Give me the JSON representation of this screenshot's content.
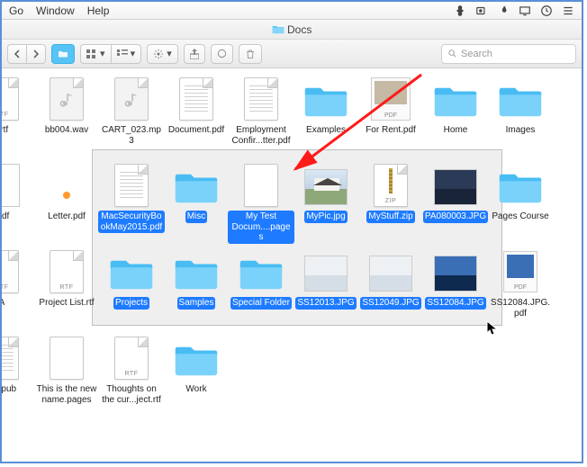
{
  "menubar": {
    "items": [
      "Go",
      "Window",
      "Help"
    ]
  },
  "window": {
    "title": "Docs"
  },
  "toolbar": {
    "search_placeholder": "Search"
  },
  "files": {
    "row1": [
      {
        "name": "r.rtf",
        "type": "rtf"
      },
      {
        "name": "bb004.wav",
        "type": "audio"
      },
      {
        "name": "CART_023.mp3",
        "type": "audio"
      },
      {
        "name": "Document.pdf",
        "type": "doc"
      },
      {
        "name": "Employment Confir...tter.pdf",
        "type": "doc"
      },
      {
        "name": "Examples",
        "type": "folder"
      },
      {
        "name": "For Rent.pdf",
        "type": "pdfimg"
      },
      {
        "name": "Home",
        "type": "folder"
      },
      {
        "name": "Images",
        "type": "folder"
      }
    ],
    "row2": [
      {
        "name": ".pdf",
        "type": "spiral"
      },
      {
        "name": "Letter.pdf",
        "type": "dot"
      },
      {
        "name": "MacSecurityBookMay2015.pdf",
        "type": "doc",
        "selected": true
      },
      {
        "name": "Misc",
        "type": "folder",
        "selected": true
      },
      {
        "name": "My Test Docum....pages",
        "type": "blank",
        "selected": true
      },
      {
        "name": "MyPic.jpg",
        "type": "img-house",
        "selected": true
      },
      {
        "name": "MyStuff.zip",
        "type": "zip",
        "selected": true
      },
      {
        "name": "PA080003.JPG",
        "type": "img-dark",
        "selected": true
      },
      {
        "name": "Pages Course",
        "type": "folder"
      }
    ],
    "row3": [
      {
        "name": "A",
        "type": "rtf"
      },
      {
        "name": "Project List.rtf",
        "type": "rtf"
      },
      {
        "name": "Projects",
        "type": "folder",
        "selected": true
      },
      {
        "name": "Samples",
        "type": "folder",
        "selected": true
      },
      {
        "name": "Special Folder",
        "type": "folder",
        "selected": true
      },
      {
        "name": "SS12013.JPG",
        "type": "img-plain",
        "selected": true
      },
      {
        "name": "SS12049.JPG",
        "type": "img-plain",
        "selected": true
      },
      {
        "name": "SS12084.JPG",
        "type": "img-blue",
        "selected": true
      },
      {
        "name": "SS12084.JPG.pdf",
        "type": "pdfsmall"
      }
    ],
    "row4": [
      {
        "name": "cal pub",
        "type": "doc"
      },
      {
        "name": "This is the new name.pages",
        "type": "blank"
      },
      {
        "name": "Thoughts on the cur...ject.rtf",
        "type": "rtf"
      },
      {
        "name": "Work",
        "type": "folder"
      }
    ]
  }
}
